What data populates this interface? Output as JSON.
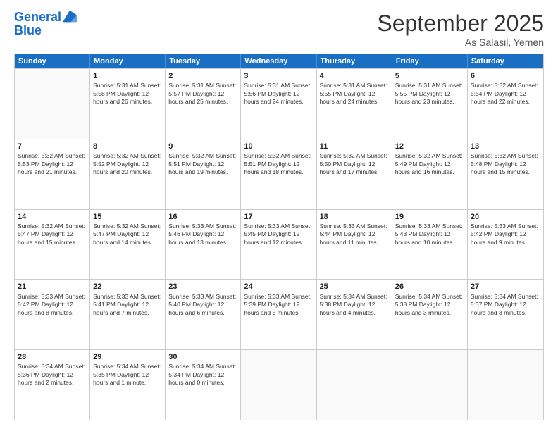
{
  "header": {
    "logo_line1": "General",
    "logo_line2": "Blue",
    "title": "September 2025",
    "subtitle": "As Salasil, Yemen"
  },
  "days": [
    "Sunday",
    "Monday",
    "Tuesday",
    "Wednesday",
    "Thursday",
    "Friday",
    "Saturday"
  ],
  "weeks": [
    [
      {
        "date": "",
        "info": ""
      },
      {
        "date": "1",
        "info": "Sunrise: 5:31 AM\nSunset: 5:58 PM\nDaylight: 12 hours\nand 26 minutes."
      },
      {
        "date": "2",
        "info": "Sunrise: 5:31 AM\nSunset: 5:57 PM\nDaylight: 12 hours\nand 25 minutes."
      },
      {
        "date": "3",
        "info": "Sunrise: 5:31 AM\nSunset: 5:56 PM\nDaylight: 12 hours\nand 24 minutes."
      },
      {
        "date": "4",
        "info": "Sunrise: 5:31 AM\nSunset: 5:55 PM\nDaylight: 12 hours\nand 24 minutes."
      },
      {
        "date": "5",
        "info": "Sunrise: 5:31 AM\nSunset: 5:55 PM\nDaylight: 12 hours\nand 23 minutes."
      },
      {
        "date": "6",
        "info": "Sunrise: 5:32 AM\nSunset: 5:54 PM\nDaylight: 12 hours\nand 22 minutes."
      }
    ],
    [
      {
        "date": "7",
        "info": "Sunrise: 5:32 AM\nSunset: 5:53 PM\nDaylight: 12 hours\nand 21 minutes."
      },
      {
        "date": "8",
        "info": "Sunrise: 5:32 AM\nSunset: 5:52 PM\nDaylight: 12 hours\nand 20 minutes."
      },
      {
        "date": "9",
        "info": "Sunrise: 5:32 AM\nSunset: 5:51 PM\nDaylight: 12 hours\nand 19 minutes."
      },
      {
        "date": "10",
        "info": "Sunrise: 5:32 AM\nSunset: 5:51 PM\nDaylight: 12 hours\nand 18 minutes."
      },
      {
        "date": "11",
        "info": "Sunrise: 5:32 AM\nSunset: 5:50 PM\nDaylight: 12 hours\nand 17 minutes."
      },
      {
        "date": "12",
        "info": "Sunrise: 5:32 AM\nSunset: 5:49 PM\nDaylight: 12 hours\nand 16 minutes."
      },
      {
        "date": "13",
        "info": "Sunrise: 5:32 AM\nSunset: 5:48 PM\nDaylight: 12 hours\nand 15 minutes."
      }
    ],
    [
      {
        "date": "14",
        "info": "Sunrise: 5:32 AM\nSunset: 5:47 PM\nDaylight: 12 hours\nand 15 minutes."
      },
      {
        "date": "15",
        "info": "Sunrise: 5:32 AM\nSunset: 5:47 PM\nDaylight: 12 hours\nand 14 minutes."
      },
      {
        "date": "16",
        "info": "Sunrise: 5:33 AM\nSunset: 5:46 PM\nDaylight: 12 hours\nand 13 minutes."
      },
      {
        "date": "17",
        "info": "Sunrise: 5:33 AM\nSunset: 5:45 PM\nDaylight: 12 hours\nand 12 minutes."
      },
      {
        "date": "18",
        "info": "Sunrise: 5:33 AM\nSunset: 5:44 PM\nDaylight: 12 hours\nand 11 minutes."
      },
      {
        "date": "19",
        "info": "Sunrise: 5:33 AM\nSunset: 5:43 PM\nDaylight: 12 hours\nand 10 minutes."
      },
      {
        "date": "20",
        "info": "Sunrise: 5:33 AM\nSunset: 5:42 PM\nDaylight: 12 hours\nand 9 minutes."
      }
    ],
    [
      {
        "date": "21",
        "info": "Sunrise: 5:33 AM\nSunset: 5:42 PM\nDaylight: 12 hours\nand 8 minutes."
      },
      {
        "date": "22",
        "info": "Sunrise: 5:33 AM\nSunset: 5:41 PM\nDaylight: 12 hours\nand 7 minutes."
      },
      {
        "date": "23",
        "info": "Sunrise: 5:33 AM\nSunset: 5:40 PM\nDaylight: 12 hours\nand 6 minutes."
      },
      {
        "date": "24",
        "info": "Sunrise: 5:33 AM\nSunset: 5:39 PM\nDaylight: 12 hours\nand 5 minutes."
      },
      {
        "date": "25",
        "info": "Sunrise: 5:34 AM\nSunset: 5:38 PM\nDaylight: 12 hours\nand 4 minutes."
      },
      {
        "date": "26",
        "info": "Sunrise: 5:34 AM\nSunset: 5:38 PM\nDaylight: 12 hours\nand 3 minutes."
      },
      {
        "date": "27",
        "info": "Sunrise: 5:34 AM\nSunset: 5:37 PM\nDaylight: 12 hours\nand 3 minutes."
      }
    ],
    [
      {
        "date": "28",
        "info": "Sunrise: 5:34 AM\nSunset: 5:36 PM\nDaylight: 12 hours\nand 2 minutes."
      },
      {
        "date": "29",
        "info": "Sunrise: 5:34 AM\nSunset: 5:35 PM\nDaylight: 12 hours\nand 1 minute."
      },
      {
        "date": "30",
        "info": "Sunrise: 5:34 AM\nSunset: 5:34 PM\nDaylight: 12 hours\nand 0 minutes."
      },
      {
        "date": "",
        "info": ""
      },
      {
        "date": "",
        "info": ""
      },
      {
        "date": "",
        "info": ""
      },
      {
        "date": "",
        "info": ""
      }
    ]
  ]
}
